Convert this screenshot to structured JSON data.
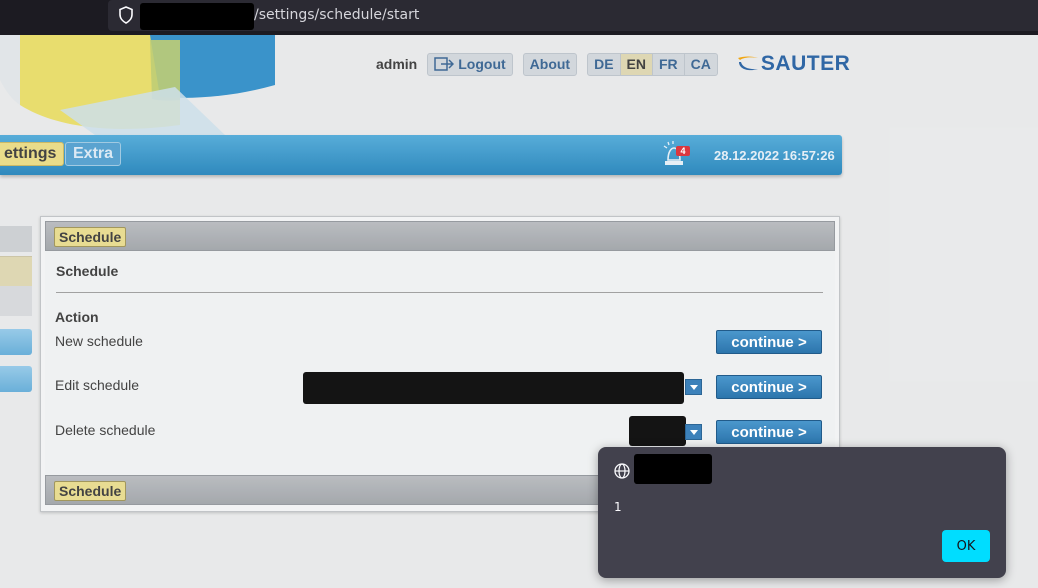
{
  "browser": {
    "url_path": "/settings/schedule/start"
  },
  "header": {
    "username": "admin",
    "logout_label": "Logout",
    "about_label": "About",
    "languages": [
      "DE",
      "EN",
      "FR",
      "CA"
    ],
    "active_language": "EN",
    "brand": "SAUTER"
  },
  "nav": {
    "tabs": [
      {
        "label": "ettings",
        "active": true
      },
      {
        "label": "Extra",
        "active": false
      }
    ],
    "alarm_count": "4",
    "datetime": "28.12.2022 16:57:26"
  },
  "panel": {
    "header_label": "Schedule",
    "title": "Schedule",
    "action_heading": "Action",
    "rows": [
      {
        "label": "New schedule",
        "button": "continue >"
      },
      {
        "label": "Edit schedule",
        "button": "continue >"
      },
      {
        "label": "Delete schedule",
        "button": "continue >"
      }
    ],
    "footer_label": "Schedule"
  },
  "dialog": {
    "message": "1",
    "ok_label": "OK"
  },
  "colors": {
    "accent_blue": "#1e80b8",
    "tab_yellow": "#e8d981",
    "dialog_bg": "#42414d",
    "ok_button": "#00ddff"
  }
}
